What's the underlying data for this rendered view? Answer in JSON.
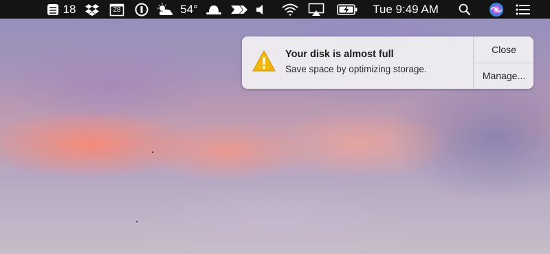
{
  "menubar": {
    "todoist_count": "18",
    "calendar_day": "28",
    "temperature": "54°",
    "clock": "Tue 9:49 AM",
    "icons": [
      "todoist-icon",
      "dropbox-icon",
      "calendar-icon",
      "1password-icon",
      "weather-icon",
      "hat-icon",
      "flyover-icon",
      "volume-icon",
      "wifi-icon",
      "airplay-icon",
      "battery-icon",
      "spotlight-icon",
      "siri-icon",
      "notification-center-icon"
    ]
  },
  "notification": {
    "title": "Your disk is almost full",
    "body": "Save space by optimizing storage.",
    "close_label": "Close",
    "manage_label": "Manage...",
    "icon": "warning-icon",
    "icon_color": "#f2b705"
  },
  "colors": {
    "menubar_bg": "#141414",
    "notification_bg": "#eeecf0"
  }
}
